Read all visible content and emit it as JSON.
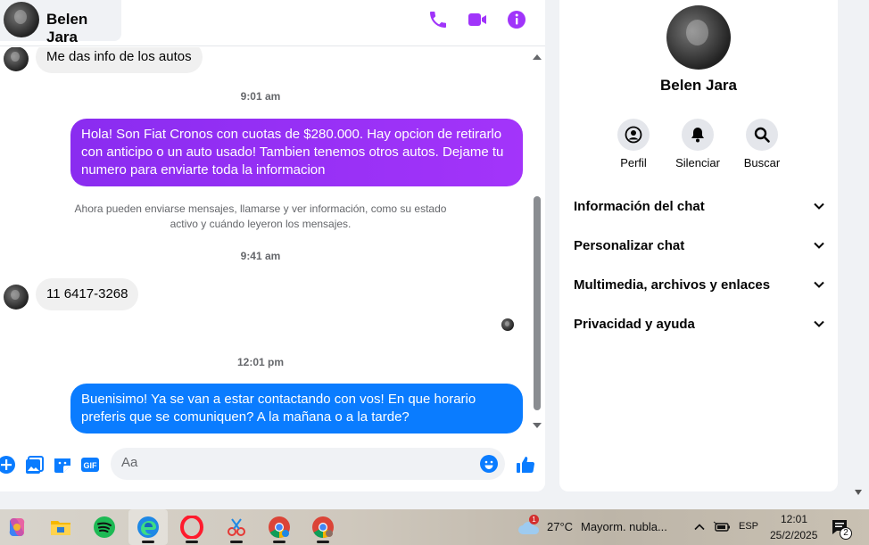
{
  "contact": {
    "name": "Belen Jara"
  },
  "messages": {
    "msg1": "Me das info de los autos",
    "time1": "9:01 am",
    "msg2": "Hola! Son Fiat Cronos con cuotas de $280.000. Hay opcion de retirarlo con anticipo o un auto usado! Tambien tenemos otros autos. Dejame tu numero para enviarte toda la informacion",
    "system": "Ahora pueden enviarse mensajes, llamarse y ver información, como su estado activo y cuándo leyeron los mensajes.",
    "time2": "9:41 am",
    "msg3": "11 6417-3268",
    "time3": "12:01 pm",
    "msg4": "Buenisimo! Ya se van a estar contactando con vos! En que horario preferis que se comuniquen? A la mañana o a la tarde?"
  },
  "composer": {
    "placeholder": "Aa",
    "gif_label": "GIF"
  },
  "info": {
    "name": "Belen Jara",
    "actions": {
      "profile": "Perfil",
      "mute": "Silenciar",
      "search": "Buscar"
    },
    "sections": {
      "chat_info": "Información del chat",
      "customize": "Personalizar chat",
      "media": "Multimedia, archivos y enlaces",
      "privacy": "Privacidad y ayuda"
    }
  },
  "taskbar": {
    "weather_temp": "27°C",
    "weather_desc": "Mayorm. nubla...",
    "weather_badge": "1",
    "language": "ESP",
    "time": "12:01",
    "date": "25/2/2025",
    "notification_count": "2"
  },
  "colors": {
    "accent": "#a034fa",
    "blue_bubble": "#0a7cff",
    "messenger_purple": "#a033ff"
  }
}
